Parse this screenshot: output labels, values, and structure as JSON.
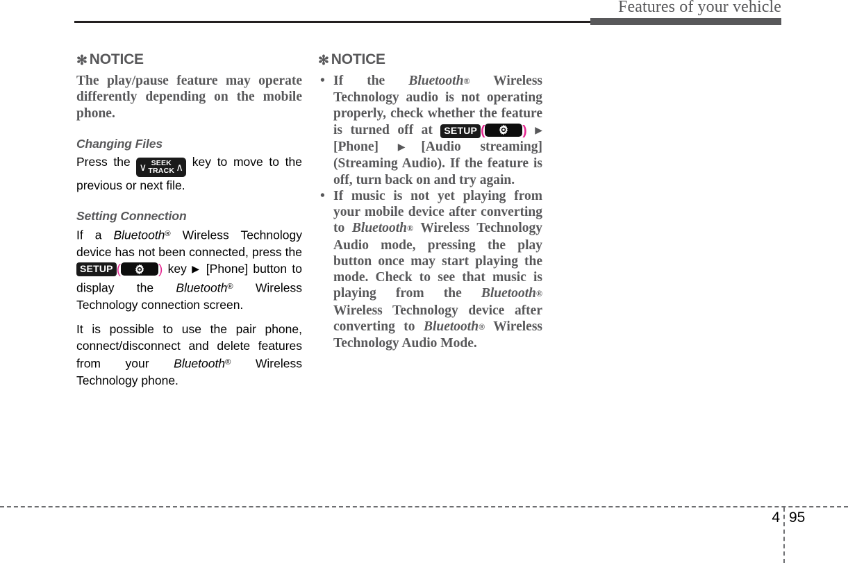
{
  "header": {
    "title": "Features of your vehicle"
  },
  "footer": {
    "chapter": "4",
    "page": "95"
  },
  "icons": {
    "notice_star": "✻",
    "triangle_right": "▶",
    "bullet_dot": "•",
    "chevron_down": "∨",
    "chevron_up": "∧",
    "paren_open": "(",
    "paren_close": ")"
  },
  "badges": {
    "setup_label": "SETUP",
    "seek_label": "SEEK",
    "track_label": "TRACK"
  },
  "left_column": {
    "notice_heading": "NOTICE",
    "notice_body": "The play/pause feature may operate differently depending on the mobile phone.",
    "changing_files": {
      "heading": "Changing Files",
      "text_before": "Press the",
      "text_after": "key to move to the previous or next file."
    },
    "setting_connection": {
      "heading": "Setting Connection",
      "p1_a": "If a",
      "p1_bluetooth": "Bluetooth",
      "p1_b": "Wireless Technology device has not been connected, press the",
      "p1_c": "key",
      "p1_d": "[Phone] button to display the",
      "p1_bluetooth2": "Bluetooth",
      "p1_e": "Wireless Technology connection screen.",
      "p2_a": "It is possible to use the pair phone, connect/disconnect and delete features from your",
      "p2_bluetooth": "Bluetooth",
      "p2_b": "Wireless Technology phone."
    }
  },
  "right_column": {
    "notice_heading": "NOTICE",
    "bullet1": {
      "a": "If the",
      "bluetooth": "Bluetooth",
      "b": "Wireless Technology audio is not operating properly, check whether the feature is turned off at",
      "c": "[Phone]",
      "d": "[Audio streaming] (Streaming Audio). If the feature is off, turn back on and try again."
    },
    "bullet2": {
      "a": "If music is not yet playing from your mobile device after converting to",
      "bluetooth1": "Bluetooth",
      "b": "Wireless Technology Audio mode, pressing the play button once may start playing the mode. Check to see that music is playing from the",
      "bluetooth2": "Bluetooth",
      "c": "Wireless Technology device after converting to",
      "bluetooth3": "Bluetooth",
      "d": "Wireless Technology Audio Mode."
    }
  },
  "colors": {
    "heading_gray": "#58585a",
    "body_black": "#000000",
    "badge_dark": "#1a1a1a",
    "accent_magenta": "#e5248f",
    "rule_dark": "#231f20"
  }
}
